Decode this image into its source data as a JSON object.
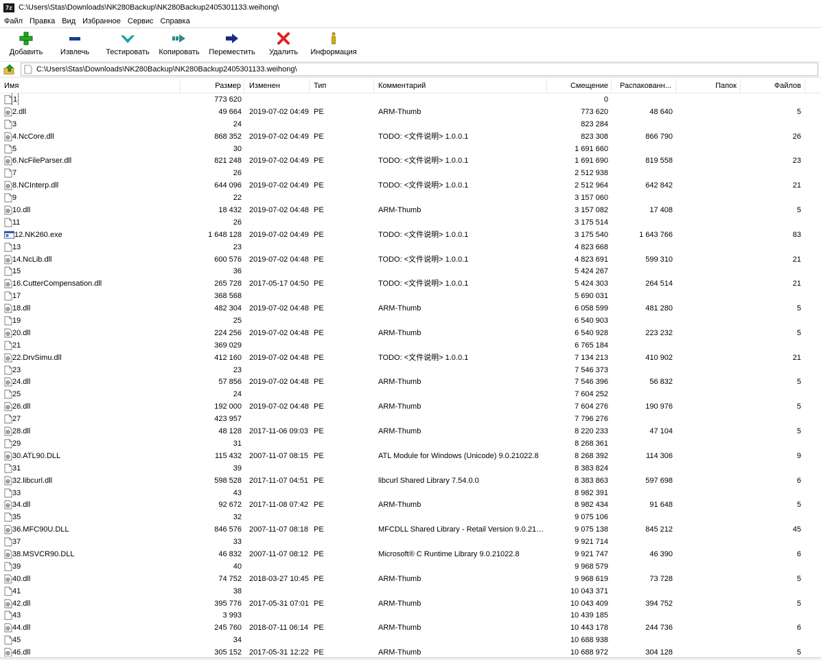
{
  "window": {
    "title": "C:\\Users\\Stas\\Downloads\\NK280Backup\\NK280Backup2405301133.weihong\\",
    "app_icon_text": "7z"
  },
  "menu": [
    "Файл",
    "Правка",
    "Вид",
    "Избранное",
    "Сервис",
    "Справка"
  ],
  "toolbar": [
    {
      "label": "Добавить",
      "icon": "plus-icon"
    },
    {
      "label": "Извлечь",
      "icon": "minus-icon"
    },
    {
      "label": "Тестировать",
      "icon": "check-icon"
    },
    {
      "label": "Копировать",
      "icon": "copy-arrow-icon"
    },
    {
      "label": "Переместить",
      "icon": "move-arrow-icon"
    },
    {
      "label": "Удалить",
      "icon": "delete-x-icon"
    },
    {
      "label": "Информация",
      "icon": "info-icon"
    }
  ],
  "address": {
    "path": "C:\\Users\\Stas\\Downloads\\NK280Backup\\NK280Backup2405301133.weihong\\"
  },
  "columns": {
    "name": "Имя",
    "size": "Размер",
    "modified": "Изменен",
    "type": "Тип",
    "comment": "Комментарий",
    "offset": "Смещение",
    "unpacked": "Распакованн...",
    "folders": "Папок",
    "files": "Файлов"
  },
  "colors": {
    "plus": "#22aa22",
    "minus": "#1a3a9a",
    "check": "#17b3c8",
    "copy": "#2f8a8a",
    "move": "#1a2a8a",
    "delete": "#e02020",
    "info": "#d4b000"
  },
  "rows": [
    {
      "name": "1",
      "icon": "blank",
      "size": "773 620",
      "modified": "",
      "type": "",
      "comment": "",
      "offset": "0",
      "unpacked": "",
      "folders": "",
      "files": ""
    },
    {
      "name": "2.dll",
      "icon": "dll",
      "size": "49 664",
      "modified": "2019-07-02 04:49",
      "type": "PE",
      "comment": "ARM-Thumb",
      "offset": "773 620",
      "unpacked": "48 640",
      "folders": "",
      "files": "5"
    },
    {
      "name": "3",
      "icon": "blank",
      "size": "24",
      "modified": "",
      "type": "",
      "comment": "",
      "offset": "823 284",
      "unpacked": "",
      "folders": "",
      "files": ""
    },
    {
      "name": "4.NcCore.dll",
      "icon": "dll",
      "size": "868 352",
      "modified": "2019-07-02 04:49",
      "type": "PE",
      "comment": "TODO: <文件说明> 1.0.0.1",
      "offset": "823 308",
      "unpacked": "866 790",
      "folders": "",
      "files": "26"
    },
    {
      "name": "5",
      "icon": "blank",
      "size": "30",
      "modified": "",
      "type": "",
      "comment": "",
      "offset": "1 691 660",
      "unpacked": "",
      "folders": "",
      "files": ""
    },
    {
      "name": "6.NcFileParser.dll",
      "icon": "dll",
      "size": "821 248",
      "modified": "2019-07-02 04:49",
      "type": "PE",
      "comment": "TODO: <文件说明> 1.0.0.1",
      "offset": "1 691 690",
      "unpacked": "819 558",
      "folders": "",
      "files": "23"
    },
    {
      "name": "7",
      "icon": "blank",
      "size": "26",
      "modified": "",
      "type": "",
      "comment": "",
      "offset": "2 512 938",
      "unpacked": "",
      "folders": "",
      "files": ""
    },
    {
      "name": "8.NCInterp.dll",
      "icon": "dll",
      "size": "644 096",
      "modified": "2019-07-02 04:49",
      "type": "PE",
      "comment": "TODO: <文件说明> 1.0.0.1",
      "offset": "2 512 964",
      "unpacked": "642 842",
      "folders": "",
      "files": "21"
    },
    {
      "name": "9",
      "icon": "blank",
      "size": "22",
      "modified": "",
      "type": "",
      "comment": "",
      "offset": "3 157 060",
      "unpacked": "",
      "folders": "",
      "files": ""
    },
    {
      "name": "10.dll",
      "icon": "dll",
      "size": "18 432",
      "modified": "2019-07-02 04:48",
      "type": "PE",
      "comment": "ARM-Thumb",
      "offset": "3 157 082",
      "unpacked": "17 408",
      "folders": "",
      "files": "5"
    },
    {
      "name": "11",
      "icon": "blank",
      "size": "26",
      "modified": "",
      "type": "",
      "comment": "",
      "offset": "3 175 514",
      "unpacked": "",
      "folders": "",
      "files": ""
    },
    {
      "name": "12.NK260.exe",
      "icon": "exe",
      "size": "1 648 128",
      "modified": "2019-07-02 04:49",
      "type": "PE",
      "comment": "TODO: <文件说明> 1.0.0.1",
      "offset": "3 175 540",
      "unpacked": "1 643 766",
      "folders": "",
      "files": "83"
    },
    {
      "name": "13",
      "icon": "blank",
      "size": "23",
      "modified": "",
      "type": "",
      "comment": "",
      "offset": "4 823 668",
      "unpacked": "",
      "folders": "",
      "files": ""
    },
    {
      "name": "14.NcLib.dll",
      "icon": "dll",
      "size": "600 576",
      "modified": "2019-07-02 04:48",
      "type": "PE",
      "comment": "TODO: <文件说明> 1.0.0.1",
      "offset": "4 823 691",
      "unpacked": "599 310",
      "folders": "",
      "files": "21"
    },
    {
      "name": "15",
      "icon": "blank",
      "size": "36",
      "modified": "",
      "type": "",
      "comment": "",
      "offset": "5 424 267",
      "unpacked": "",
      "folders": "",
      "files": ""
    },
    {
      "name": "16.CutterCompensation.dll",
      "icon": "dll",
      "size": "265 728",
      "modified": "2017-05-17 04:50",
      "type": "PE",
      "comment": "TODO: <文件说明> 1.0.0.1",
      "offset": "5 424 303",
      "unpacked": "264 514",
      "folders": "",
      "files": "21"
    },
    {
      "name": "17",
      "icon": "blank",
      "size": "368 568",
      "modified": "",
      "type": "",
      "comment": "",
      "offset": "5 690 031",
      "unpacked": "",
      "folders": "",
      "files": ""
    },
    {
      "name": "18.dll",
      "icon": "dll",
      "size": "482 304",
      "modified": "2019-07-02 04:48",
      "type": "PE",
      "comment": "ARM-Thumb",
      "offset": "6 058 599",
      "unpacked": "481 280",
      "folders": "",
      "files": "5"
    },
    {
      "name": "19",
      "icon": "blank",
      "size": "25",
      "modified": "",
      "type": "",
      "comment": "",
      "offset": "6 540 903",
      "unpacked": "",
      "folders": "",
      "files": ""
    },
    {
      "name": "20.dll",
      "icon": "dll",
      "size": "224 256",
      "modified": "2019-07-02 04:48",
      "type": "PE",
      "comment": "ARM-Thumb",
      "offset": "6 540 928",
      "unpacked": "223 232",
      "folders": "",
      "files": "5"
    },
    {
      "name": "21",
      "icon": "blank",
      "size": "369 029",
      "modified": "",
      "type": "",
      "comment": "",
      "offset": "6 765 184",
      "unpacked": "",
      "folders": "",
      "files": ""
    },
    {
      "name": "22.DrvSimu.dll",
      "icon": "dll",
      "size": "412 160",
      "modified": "2019-07-02 04:48",
      "type": "PE",
      "comment": "TODO: <文件说明> 1.0.0.1",
      "offset": "7 134 213",
      "unpacked": "410 902",
      "folders": "",
      "files": "21"
    },
    {
      "name": "23",
      "icon": "blank",
      "size": "23",
      "modified": "",
      "type": "",
      "comment": "",
      "offset": "7 546 373",
      "unpacked": "",
      "folders": "",
      "files": ""
    },
    {
      "name": "24.dll",
      "icon": "dll",
      "size": "57 856",
      "modified": "2019-07-02 04:48",
      "type": "PE",
      "comment": "ARM-Thumb",
      "offset": "7 546 396",
      "unpacked": "56 832",
      "folders": "",
      "files": "5"
    },
    {
      "name": "25",
      "icon": "blank",
      "size": "24",
      "modified": "",
      "type": "",
      "comment": "",
      "offset": "7 604 252",
      "unpacked": "",
      "folders": "",
      "files": ""
    },
    {
      "name": "26.dll",
      "icon": "dll",
      "size": "192 000",
      "modified": "2019-07-02 04:48",
      "type": "PE",
      "comment": "ARM-Thumb",
      "offset": "7 604 276",
      "unpacked": "190 976",
      "folders": "",
      "files": "5"
    },
    {
      "name": "27",
      "icon": "blank",
      "size": "423 957",
      "modified": "",
      "type": "",
      "comment": "",
      "offset": "7 796 276",
      "unpacked": "",
      "folders": "",
      "files": ""
    },
    {
      "name": "28.dll",
      "icon": "dll",
      "size": "48 128",
      "modified": "2017-11-06 09:03",
      "type": "PE",
      "comment": "ARM-Thumb",
      "offset": "8 220 233",
      "unpacked": "47 104",
      "folders": "",
      "files": "5"
    },
    {
      "name": "29",
      "icon": "blank",
      "size": "31",
      "modified": "",
      "type": "",
      "comment": "",
      "offset": "8 268 361",
      "unpacked": "",
      "folders": "",
      "files": ""
    },
    {
      "name": "30.ATL90.DLL",
      "icon": "dll",
      "size": "115 432",
      "modified": "2007-11-07 08:15",
      "type": "PE",
      "comment": "ATL Module for Windows (Unicode) 9.0.21022.8",
      "offset": "8 268 392",
      "unpacked": "114 306",
      "folders": "",
      "files": "9"
    },
    {
      "name": "31",
      "icon": "blank",
      "size": "39",
      "modified": "",
      "type": "",
      "comment": "",
      "offset": "8 383 824",
      "unpacked": "",
      "folders": "",
      "files": ""
    },
    {
      "name": "32.libcurl.dll",
      "icon": "dll",
      "size": "598 528",
      "modified": "2017-11-07 04:51",
      "type": "PE",
      "comment": "libcurl Shared Library 7.54.0.0",
      "offset": "8 383 863",
      "unpacked": "597 698",
      "folders": "",
      "files": "6"
    },
    {
      "name": "33",
      "icon": "blank",
      "size": "43",
      "modified": "",
      "type": "",
      "comment": "",
      "offset": "8 982 391",
      "unpacked": "",
      "folders": "",
      "files": ""
    },
    {
      "name": "34.dll",
      "icon": "dll",
      "size": "92 672",
      "modified": "2017-11-08 07:42",
      "type": "PE",
      "comment": "ARM-Thumb",
      "offset": "8 982 434",
      "unpacked": "91 648",
      "folders": "",
      "files": "5"
    },
    {
      "name": "35",
      "icon": "blank",
      "size": "32",
      "modified": "",
      "type": "",
      "comment": "",
      "offset": "9 075 106",
      "unpacked": "",
      "folders": "",
      "files": ""
    },
    {
      "name": "36.MFC90U.DLL",
      "icon": "dll",
      "size": "846 576",
      "modified": "2007-11-07 08:18",
      "type": "PE",
      "comment": "MFCDLL Shared Library - Retail Version 9.0.210...",
      "offset": "9 075 138",
      "unpacked": "845 212",
      "folders": "",
      "files": "45"
    },
    {
      "name": "37",
      "icon": "blank",
      "size": "33",
      "modified": "",
      "type": "",
      "comment": "",
      "offset": "9 921 714",
      "unpacked": "",
      "folders": "",
      "files": ""
    },
    {
      "name": "38.MSVCR90.DLL",
      "icon": "dll",
      "size": "46 832",
      "modified": "2007-11-07 08:12",
      "type": "PE",
      "comment": "Microsoft® C Runtime Library 9.0.21022.8",
      "offset": "9 921 747",
      "unpacked": "46 390",
      "folders": "",
      "files": "6"
    },
    {
      "name": "39",
      "icon": "blank",
      "size": "40",
      "modified": "",
      "type": "",
      "comment": "",
      "offset": "9 968 579",
      "unpacked": "",
      "folders": "",
      "files": ""
    },
    {
      "name": "40.dll",
      "icon": "dll",
      "size": "74 752",
      "modified": "2018-03-27 10:45",
      "type": "PE",
      "comment": "ARM-Thumb",
      "offset": "9 968 619",
      "unpacked": "73 728",
      "folders": "",
      "files": "5"
    },
    {
      "name": "41",
      "icon": "blank",
      "size": "38",
      "modified": "",
      "type": "",
      "comment": "",
      "offset": "10 043 371",
      "unpacked": "",
      "folders": "",
      "files": ""
    },
    {
      "name": "42.dll",
      "icon": "dll",
      "size": "395 776",
      "modified": "2017-05-31 07:01",
      "type": "PE",
      "comment": "ARM-Thumb",
      "offset": "10 043 409",
      "unpacked": "394 752",
      "folders": "",
      "files": "5"
    },
    {
      "name": "43",
      "icon": "blank",
      "size": "3 993",
      "modified": "",
      "type": "",
      "comment": "",
      "offset": "10 439 185",
      "unpacked": "",
      "folders": "",
      "files": ""
    },
    {
      "name": "44.dll",
      "icon": "dll",
      "size": "245 760",
      "modified": "2018-07-11 06:14",
      "type": "PE",
      "comment": "ARM-Thumb",
      "offset": "10 443 178",
      "unpacked": "244 736",
      "folders": "",
      "files": "6"
    },
    {
      "name": "45",
      "icon": "blank",
      "size": "34",
      "modified": "",
      "type": "",
      "comment": "",
      "offset": "10 688 938",
      "unpacked": "",
      "folders": "",
      "files": ""
    },
    {
      "name": "46.dll",
      "icon": "dll",
      "size": "305 152",
      "modified": "2017-05-31 12:22",
      "type": "PE",
      "comment": "ARM-Thumb",
      "offset": "10 688 972",
      "unpacked": "304 128",
      "folders": "",
      "files": "5"
    }
  ]
}
